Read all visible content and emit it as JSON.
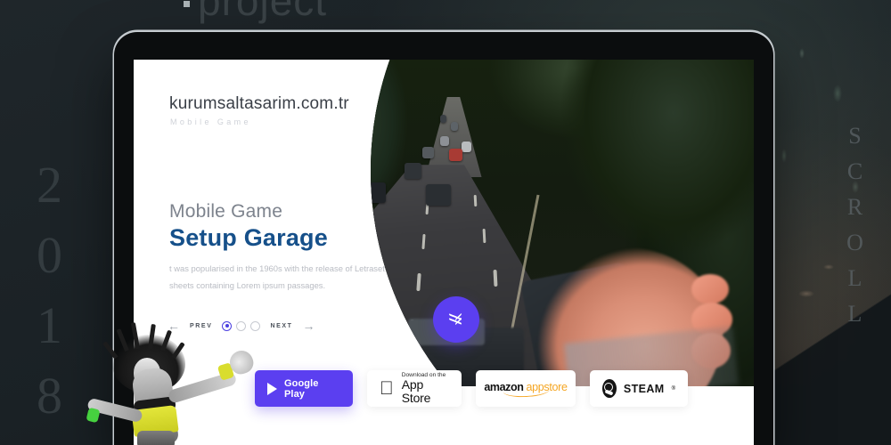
{
  "background": {
    "top_word": "project",
    "year_vertical": "2018",
    "scroll_vertical": "SCROLL",
    "bg_color": "#1d2327"
  },
  "device": {
    "type": "laptop-mockup",
    "bezel_color": "#0b0d0e",
    "edge_color": "#c6ccd0"
  },
  "site": {
    "brand": "kurumsaltasarim.com.tr",
    "brand_sub": "Mobile Game",
    "hero": {
      "kicker": "Mobile Game",
      "headline": "Setup Garage",
      "headline_color": "#16508a",
      "description_line1": "t was popularised in the 1960s with the release of Letraset",
      "description_line2": "sheets containing Lorem ipsum passages."
    },
    "pager": {
      "prev_arrow": "←",
      "prev_label": "PREV",
      "next_label": "NEXT",
      "next_arrow": "→",
      "dot_count": 3,
      "active_index": 0,
      "active_color": "#4b3fe0"
    },
    "scroll_button": {
      "icon": "double-chevron-down-icon",
      "color": "#5b3ff0"
    },
    "hero_image": {
      "alt": "aerial road with cars and trees, hand holding phone",
      "shape": "blob-ellipse"
    },
    "stores": [
      {
        "id": "google-play",
        "icon": "play-triangle-icon",
        "label": "Google Play",
        "bg": "#5b3ff0",
        "fg": "#ffffff"
      },
      {
        "id": "app-store",
        "icon": "apple-logo-icon",
        "small_label": "Download on the",
        "label": "App Store",
        "bg": "#ffffff",
        "fg": "#111111"
      },
      {
        "id": "amazon-appstore",
        "icon": "amazon-smile-icon",
        "label_part1": "amazon",
        "label_part2": "appstore",
        "bg": "#ffffff",
        "fg": "#111111",
        "accent": "#f5a623"
      },
      {
        "id": "steam",
        "icon": "steam-logo-icon",
        "label": "STEAM",
        "trademark": "®",
        "bg": "#ffffff",
        "fg": "#141414"
      }
    ]
  },
  "overlay": {
    "dancer_alt": "woman dancing, black and white photo with yellow sports top"
  }
}
